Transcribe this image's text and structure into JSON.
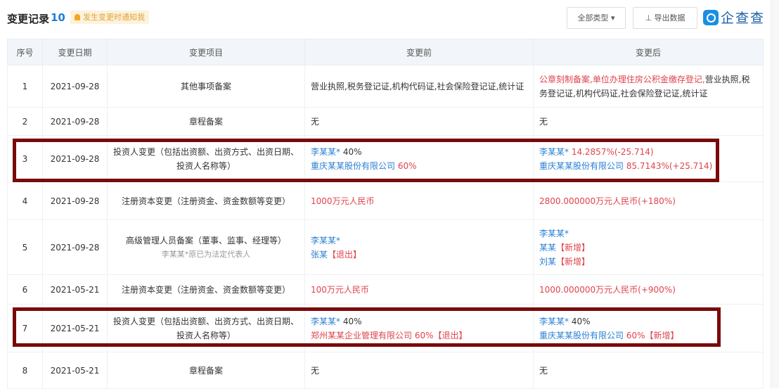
{
  "header": {
    "title": "变更记录",
    "count": "10",
    "notify_badge": "发生变更时通知我",
    "type_filter": "全部类型",
    "export_label": "导出数据",
    "logo_text": "企查查"
  },
  "columns": [
    "序号",
    "变更日期",
    "变更项目",
    "变更前",
    "变更后"
  ],
  "rows": [
    {
      "no": "1",
      "date": "2021-09-28",
      "item": "其他事项备案",
      "item_note": "",
      "before": [
        {
          "t": "营业执照,税务登记证,机构代码证,社会保险登记证,统计证",
          "c": ""
        }
      ],
      "after": [
        {
          "t": "公章刻制备案,单位办理住房公积金缴存登记,",
          "c": "red"
        },
        {
          "t": "营业执照,税务登记证,机构代码证,社会保险登记证,统计证",
          "c": ""
        }
      ]
    },
    {
      "no": "2",
      "date": "2021-09-28",
      "item": "章程备案",
      "item_note": "",
      "before": [
        {
          "t": "无",
          "c": ""
        }
      ],
      "after": [
        {
          "t": "无",
          "c": ""
        }
      ]
    },
    {
      "no": "3",
      "date": "2021-09-28",
      "item": "投资人变更（包括出资额、出资方式、出资日期、投资人名称等）",
      "item_note": "",
      "before": [
        {
          "t": "李某某*",
          "c": "blue"
        },
        {
          "t": " 40%",
          "c": "",
          "br": true
        },
        {
          "t": "重庆某某股份有限公司",
          "c": "blue"
        },
        {
          "t": " 60%",
          "c": "red"
        }
      ],
      "after": [
        {
          "t": "李某某*",
          "c": "blue"
        },
        {
          "t": " 14.2857%(-25.714)",
          "c": "red",
          "br": true
        },
        {
          "t": "重庆某某股份有限公司",
          "c": "blue"
        },
        {
          "t": " 85.7143%(+25.714)",
          "c": "red"
        }
      ]
    },
    {
      "no": "4",
      "date": "2021-09-28",
      "item": "注册资本变更（注册资金、资金数额等变更）",
      "item_note": "",
      "before": [
        {
          "t": "1000万元人民币",
          "c": "red"
        }
      ],
      "after": [
        {
          "t": "2800.000000万元人民币(+180%)",
          "c": "red"
        }
      ]
    },
    {
      "no": "5",
      "date": "2021-09-28",
      "item": "高级管理人员备案（董事、监事、经理等）",
      "item_note": "李某某*原已为法定代表人",
      "before": [
        {
          "t": "李某某*",
          "c": "blue",
          "br": true
        },
        {
          "t": "张某",
          "c": "blue"
        },
        {
          "t": "【退出】",
          "c": "red"
        }
      ],
      "after": [
        {
          "t": "李某某*",
          "c": "blue",
          "br": true
        },
        {
          "t": "某某",
          "c": "blue"
        },
        {
          "t": "【新增】",
          "c": "red",
          "br": true
        },
        {
          "t": "刘某",
          "c": "blue"
        },
        {
          "t": "【新增】",
          "c": "red"
        }
      ]
    },
    {
      "no": "6",
      "date": "2021-05-21",
      "item": "注册资本变更（注册资金、资金数额等变更）",
      "item_note": "",
      "before": [
        {
          "t": "100万元人民币",
          "c": "red"
        }
      ],
      "after": [
        {
          "t": "1000.000000万元人民币(+900%)",
          "c": "red"
        }
      ]
    },
    {
      "no": "7",
      "date": "2021-05-21",
      "item": "投资人变更（包括出资额、出资方式、出资日期、投资人名称等）",
      "item_note": "",
      "before": [
        {
          "t": "李某某*",
          "c": "blue"
        },
        {
          "t": " 40%",
          "c": "",
          "br": true
        },
        {
          "t": "郑州某某企业管理有限公司 60%【退出】",
          "c": "red"
        }
      ],
      "after": [
        {
          "t": "李某某*",
          "c": "blue"
        },
        {
          "t": " 40%",
          "c": "",
          "br": true
        },
        {
          "t": "重庆某某股份有限公司",
          "c": "blue"
        },
        {
          "t": " 60%【新增】",
          "c": "red"
        }
      ]
    },
    {
      "no": "8",
      "date": "2021-05-21",
      "item": "章程备案",
      "item_note": "",
      "before": [
        {
          "t": "无",
          "c": ""
        }
      ],
      "after": [
        {
          "t": "无",
          "c": ""
        }
      ]
    }
  ]
}
